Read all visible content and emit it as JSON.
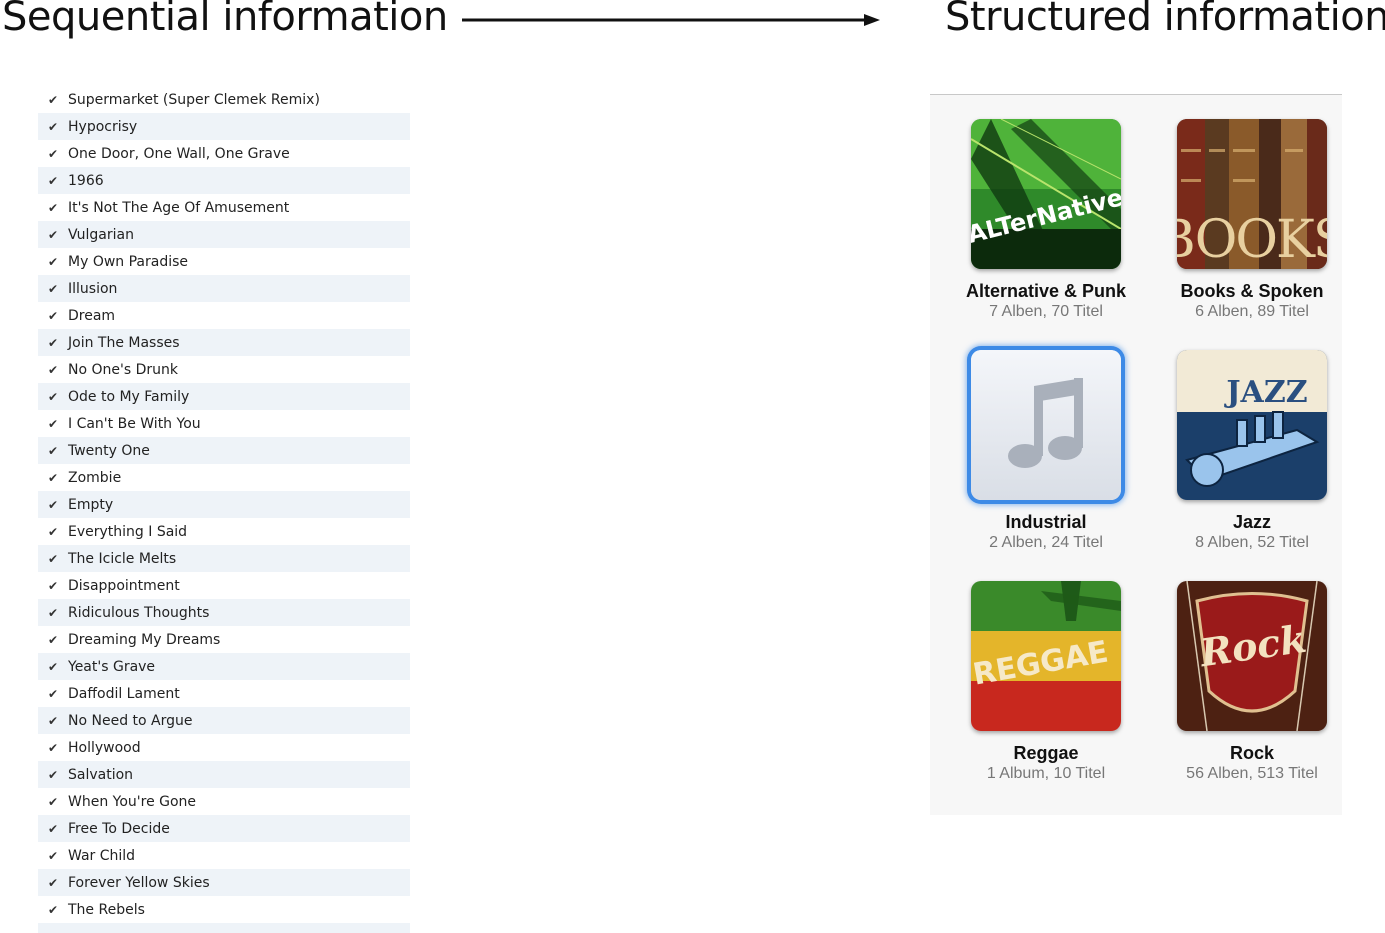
{
  "headings": {
    "left": "Sequential information",
    "right": "Structured information"
  },
  "tracks": [
    "Supermarket (Super Clemek Remix)",
    "Hypocrisy",
    "One Door, One Wall, One Grave",
    "1966",
    "It's Not The Age Of Amusement",
    "Vulgarian",
    "My Own Paradise",
    "Illusion",
    "Dream",
    "Join The Masses",
    "No One's Drunk",
    "Ode to My Family",
    "I Can't Be With You",
    "Twenty One",
    "Zombie",
    "Empty",
    "Everything I Said",
    "The Icicle Melts",
    "Disappointment",
    "Ridiculous Thoughts",
    "Dreaming My Dreams",
    "Yeat's Grave",
    "Daffodil Lament",
    "No Need to Argue",
    "Hollywood",
    "Salvation",
    "When You're Gone",
    "Free To Decide",
    "War Child",
    "Forever Yellow Skies",
    "The Rebels"
  ],
  "check_glyph": "✔",
  "genres": [
    {
      "name": "Alternative & Punk",
      "meta": "7 Alben, 70 Titel",
      "art_text": "ALTerNative",
      "art": "alternative"
    },
    {
      "name": "Books & Spoken",
      "meta": "6 Alben, 89 Titel",
      "art_text": "BOOKS",
      "art": "books"
    },
    {
      "name": "Industrial",
      "meta": "2 Alben, 24 Titel",
      "art_text": "",
      "art": "note",
      "selected": true
    },
    {
      "name": "Jazz",
      "meta": "8 Alben, 52 Titel",
      "art_text": "JAZZ",
      "art": "jazz"
    },
    {
      "name": "Reggae",
      "meta": "1 Album, 10 Titel",
      "art_text": "REGGAE",
      "art": "reggae"
    },
    {
      "name": "Rock",
      "meta": "56 Alben, 513 Titel",
      "art_text": "Rock",
      "art": "rock"
    }
  ]
}
